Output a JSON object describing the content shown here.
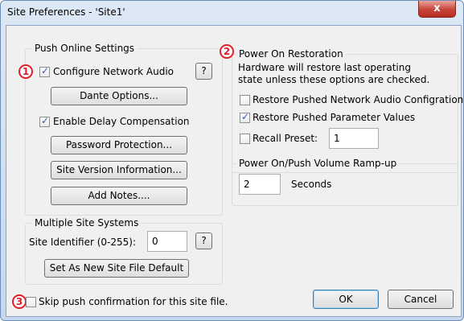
{
  "window": {
    "title": "Site Preferences - 'Site1'",
    "close_label": "x"
  },
  "push_online": {
    "legend": "Push Online Settings",
    "marker": "1",
    "configure_network_audio": {
      "label": "Configure Network Audio",
      "checked": true
    },
    "help_label": "?",
    "dante_options": "Dante Options...",
    "enable_delay": {
      "label": "Enable Delay Compensation",
      "checked": true
    },
    "password_protection": "Password Protection...",
    "site_version_information": "Site Version Information...",
    "add_notes": "Add Notes...."
  },
  "multiple_site": {
    "legend": "Multiple Site Systems",
    "identifier_label": "Site Identifier (0-255):",
    "identifier_value": "0",
    "help_label": "?",
    "set_default": "Set As New Site File Default"
  },
  "power_on": {
    "legend": "Power On Restoration",
    "marker": "2",
    "description_line1": "Hardware will restore last operating",
    "description_line2": "state unless these options are checked.",
    "restore_network_audio": {
      "label": "Restore Pushed Network Audio Configration",
      "checked": false
    },
    "restore_parameters": {
      "label": "Restore Pushed Parameter Values",
      "checked": true
    },
    "recall_preset": {
      "label": "Recall Preset:",
      "checked": false,
      "value": "1"
    }
  },
  "volume_ramp": {
    "legend": "Power On/Push Volume Ramp-up",
    "value": "2",
    "unit_label": "Seconds"
  },
  "footer": {
    "marker": "3",
    "skip_confirmation": {
      "label": "Skip push confirmation for this site file.",
      "checked": false
    },
    "ok_label": "OK",
    "cancel_label": "Cancel"
  },
  "colors": {
    "marker": "#e0202a",
    "accent": "#2b5ea8"
  }
}
